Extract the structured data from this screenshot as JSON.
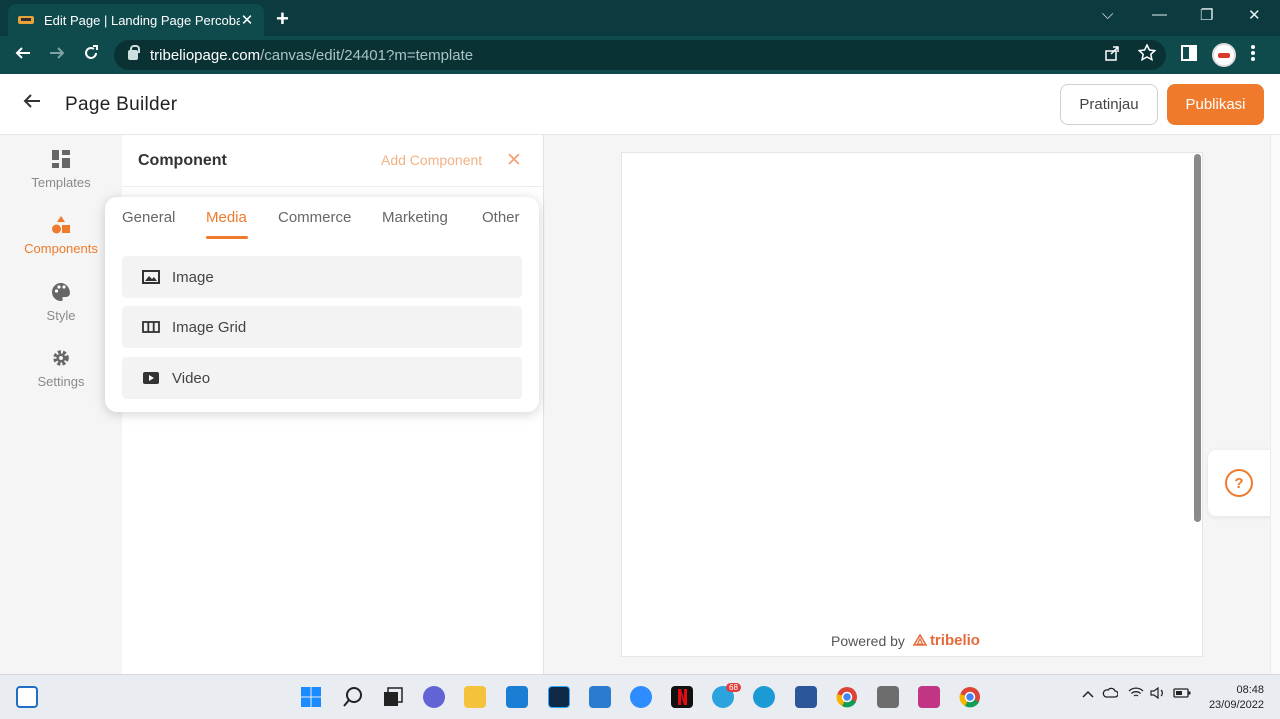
{
  "browser": {
    "tab_title": "Edit Page | Landing Page Percoba",
    "tab_close": "✕",
    "new_tab": "+",
    "url_host": "tribeliopage.com",
    "url_path": "/canvas/edit/24401?m=template",
    "window_controls": {
      "dropdown": "⌵",
      "minimize": "—",
      "restore": "❐",
      "close": "✕"
    }
  },
  "header": {
    "back_icon": "arrow-left-icon",
    "title": "Page Builder",
    "preview_label": "Pratinjau",
    "publish_label": "Publikasi"
  },
  "rail": {
    "items": [
      {
        "label": "Templates",
        "icon": "templates-icon",
        "active": false
      },
      {
        "label": "Components",
        "icon": "components-icon",
        "active": true
      },
      {
        "label": "Style",
        "icon": "palette-icon",
        "active": false
      },
      {
        "label": "Settings",
        "icon": "gear-icon",
        "active": false
      }
    ]
  },
  "panel": {
    "title": "Component",
    "add_component": "Add Component",
    "close_icon": "✕"
  },
  "popover": {
    "tabs": [
      {
        "label": "General",
        "active": false
      },
      {
        "label": "Media",
        "active": true
      },
      {
        "label": "Commerce",
        "active": false
      },
      {
        "label": "Marketing",
        "active": false
      },
      {
        "label": "Other",
        "active": false
      }
    ],
    "items": [
      {
        "label": "Image",
        "icon": "image-icon"
      },
      {
        "label": "Image Grid",
        "icon": "image-grid-icon"
      },
      {
        "label": "Video",
        "icon": "video-icon"
      }
    ]
  },
  "canvas": {
    "powered_by": "Powered by",
    "brand": "tribelio",
    "help": "?"
  },
  "taskbar": {
    "time": "08:48",
    "date": "23/09/2022",
    "telegram_badge": "68"
  },
  "colors": {
    "accent": "#ef7a2c",
    "chrome": "#0f4a4d"
  }
}
